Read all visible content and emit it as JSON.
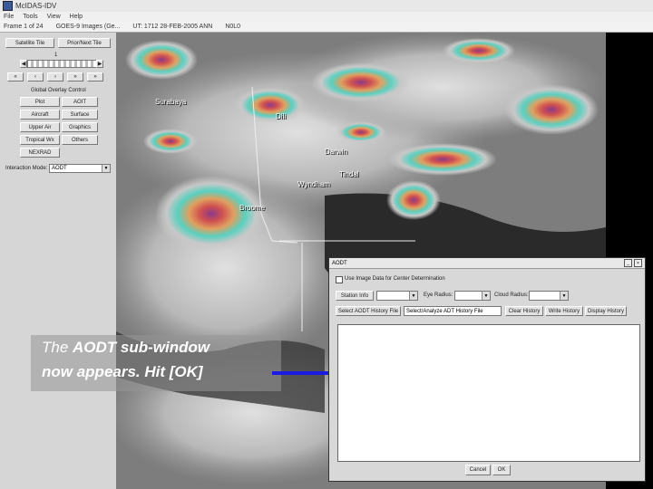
{
  "window": {
    "title": "McIDAS-IDV"
  },
  "menu": {
    "items": [
      "File",
      "Tools",
      "View",
      "Help"
    ]
  },
  "status": {
    "items": [
      "Frame 1 of 24",
      "GOES-9 Images (Ge...",
      "UT: 1712 28-FEB-2005 ANN",
      "N0L0"
    ]
  },
  "panel": {
    "top_left_button": "Satellite Tile",
    "top_right_button": "Prior/Next Tile",
    "frame_number": "1",
    "global_overlay_label": "Global Overlay Control",
    "overlay_buttons": [
      "Plot",
      "AOIT",
      "Aircraft",
      "Surface",
      "Upper Air",
      "Graphics",
      "Tropical Wx",
      "Others",
      "NEXRAD"
    ],
    "interaction_mode_label": "Interaction Mode:",
    "interaction_mode_value": "AODT"
  },
  "map": {
    "cities": [
      "Surabaya",
      "Dili",
      "Darwin",
      "Tindal",
      "Wyndham",
      "Broome"
    ]
  },
  "dialog": {
    "title": "AODT",
    "checkbox_label": "Use Image Data for Center Determination",
    "row1": {
      "station_button": "Station Info",
      "station_value": "",
      "eye_label": "Eye Radius:",
      "eye_value": "",
      "cloud_label": "Cloud Radius:",
      "cloud_value": ""
    },
    "row2": {
      "history_button": "Select AODT History File",
      "history_value": "Select/Analyze ADT History File",
      "clear_button": "Clear History",
      "write_button": "Write History",
      "display_button": "Display History"
    },
    "cancel_button": "Cancel",
    "ok_button": "OK"
  },
  "callout": {
    "line1_prefix": "The ",
    "line1_emph": "AODT sub-window",
    "line2": "now appears. Hit [OK]"
  },
  "colors": {
    "arrow": "#1a1ae0",
    "callout_text": "#ffffff"
  }
}
